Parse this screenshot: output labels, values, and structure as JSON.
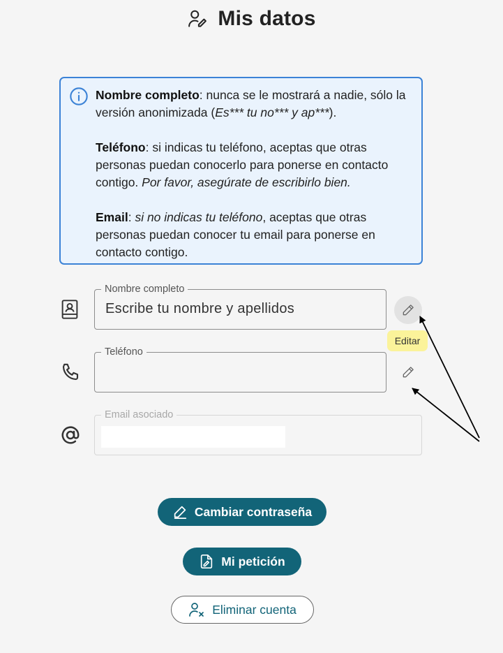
{
  "header": {
    "title": "Mis datos",
    "icon": "user-edit-icon"
  },
  "info": {
    "p1": {
      "bold": "Nombre completo",
      "text": ": nunca se le mostrará a nadie, sólo la versión anonimizada (",
      "italic": "Es*** tu no*** y ap***",
      "end": ")."
    },
    "p2": {
      "bold": "Teléfono",
      "text": ": si indicas tu teléfono, aceptas que otras personas puedan conocerlo para ponerse en contacto contigo. ",
      "italic": "Por favor, asegúrate de escribirlo bien."
    },
    "p3": {
      "bold": "Email",
      "sep": ": ",
      "italic": "si no indicas tu teléfono",
      "text": ", aceptas que otras personas puedan conocer tu email para ponerse en contacto contigo."
    }
  },
  "fields": {
    "name": {
      "label": "Nombre completo",
      "placeholder": "Escribe tu nombre y apellidos",
      "icon": "contact-book-icon"
    },
    "phone": {
      "label": "Teléfono",
      "value": "",
      "icon": "phone-icon"
    },
    "email": {
      "label": "Email asociado",
      "icon": "at-sign-icon"
    }
  },
  "tooltip": "Editar",
  "buttons": {
    "change_password": "Cambiar contraseña",
    "my_request": "Mi petición",
    "delete_account": "Eliminar cuenta"
  },
  "colors": {
    "primary": "#126478",
    "info_border": "#3b82d6",
    "info_bg": "#eaf3fd",
    "tooltip": "#fbf39a"
  }
}
